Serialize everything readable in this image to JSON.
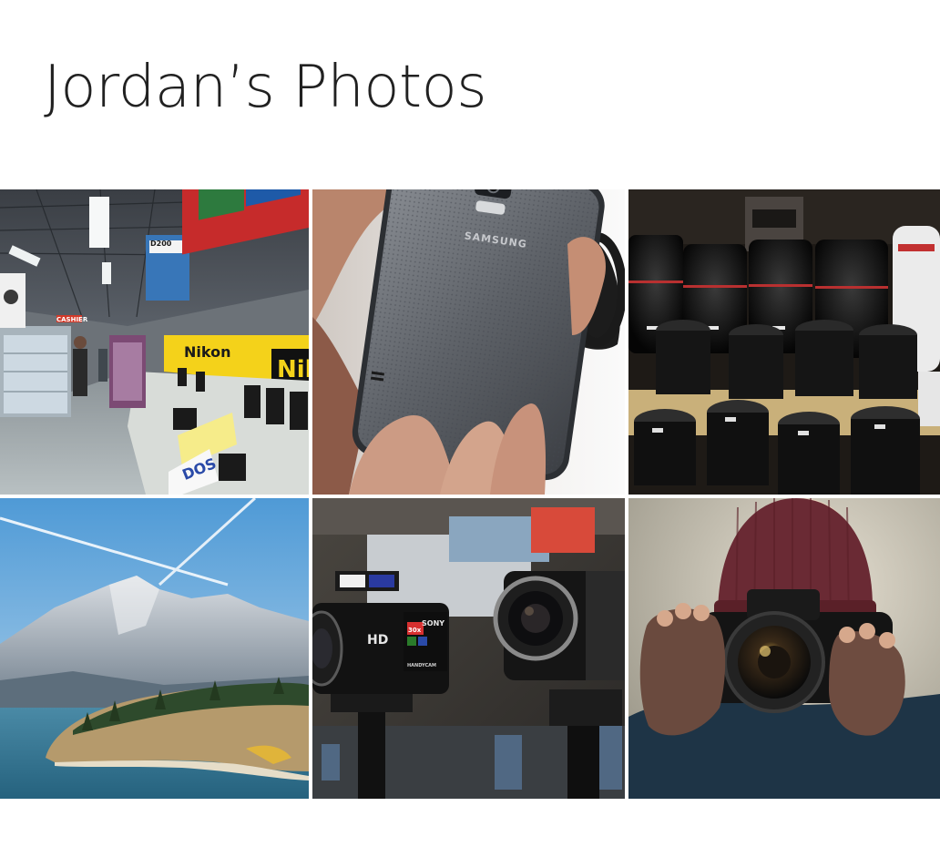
{
  "header": {
    "title": "Jordan’s Photos"
  },
  "photos": [
    {
      "name": "camera-store-aisle",
      "sign_labels": [
        "Nikon",
        "Nik",
        "DOS",
        "CASHIER",
        "D200"
      ]
    },
    {
      "name": "samsung-phone-in-hand",
      "brand_text": "SAMSUNG"
    },
    {
      "name": "lens-shelf"
    },
    {
      "name": "mountain-lake"
    },
    {
      "name": "camcorders-display",
      "labels": [
        "HD",
        "SONY",
        "30x",
        "HANDYCAM"
      ]
    },
    {
      "name": "person-holding-camera"
    }
  ],
  "colors": {
    "background": "#ffffff",
    "title": "#212121",
    "gap": "#ffffff"
  }
}
